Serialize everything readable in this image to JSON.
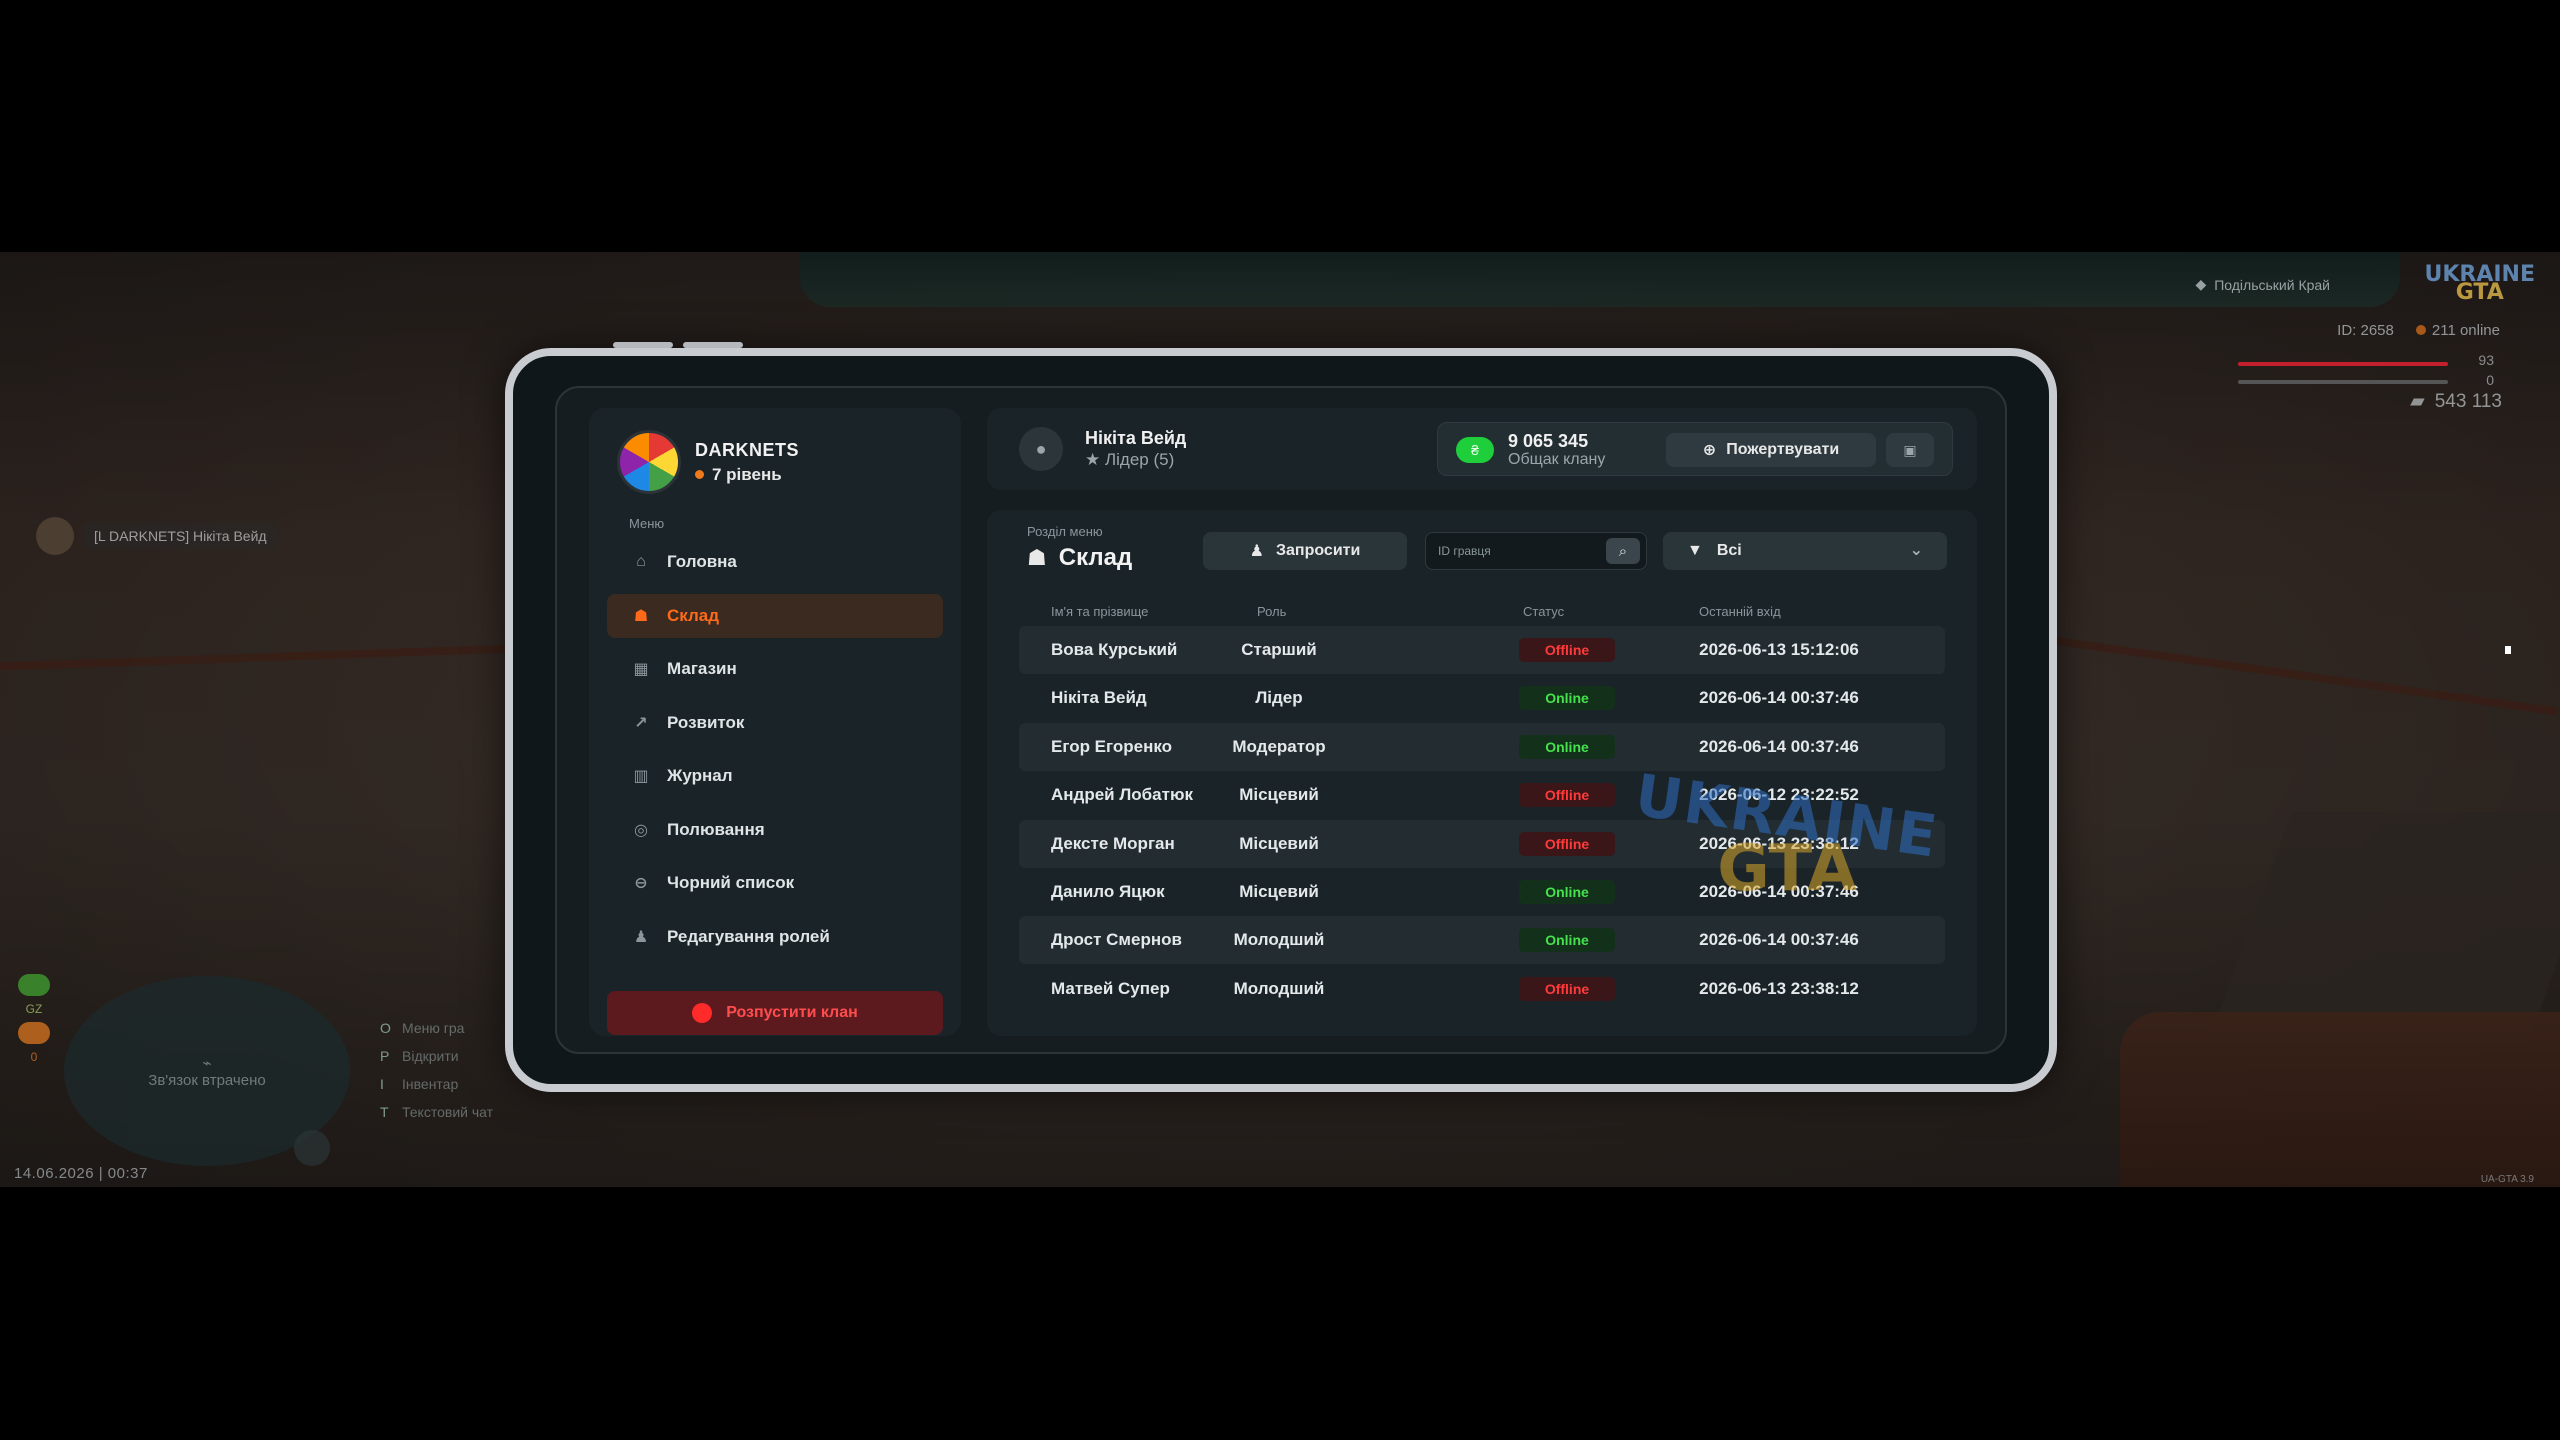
{
  "hud": {
    "region": "Подільський Край",
    "logo_top": "UKRAINE",
    "logo_bottom": "GTA",
    "player_id": "ID: 2658",
    "online": "211 online",
    "hp": "93",
    "armor": "0",
    "money": "543 113",
    "chat_tag": "[L DARKNETS] Нікіта Вейд",
    "minimap_text": "Зв'язок втрачено",
    "gz": "GZ",
    "gz_count": "0",
    "keys": [
      {
        "key": "O",
        "label": "Меню гра"
      },
      {
        "key": "P",
        "label": "Відкрити"
      },
      {
        "key": "I",
        "label": "Інвентар"
      },
      {
        "key": "T",
        "label": "Текстовий чат"
      }
    ],
    "datetime": "14.06.2026 | 00:37",
    "version": "UA-GTA 3.9"
  },
  "clan": {
    "name": "DARKNETS",
    "level": "7 рівень"
  },
  "menu": {
    "caption": "Меню",
    "items": [
      {
        "label": "Головна",
        "icon": "home-icon",
        "glyph": "⌂"
      },
      {
        "label": "Склад",
        "icon": "members-icon",
        "glyph": "☗"
      },
      {
        "label": "Магазин",
        "icon": "shop-basket-icon",
        "glyph": "▦"
      },
      {
        "label": "Розвиток",
        "icon": "chart-icon",
        "glyph": "↗"
      },
      {
        "label": "Журнал",
        "icon": "book-icon",
        "glyph": "▥"
      },
      {
        "label": "Полювання",
        "icon": "target-icon",
        "glyph": "◎"
      },
      {
        "label": "Чорний список",
        "icon": "block-icon",
        "glyph": "⊖"
      },
      {
        "label": "Редагування ролей",
        "icon": "user-edit-icon",
        "glyph": "♟"
      }
    ],
    "active_index": 1,
    "disband_label": "Розпустити клан"
  },
  "user": {
    "name": "Нікіта Вейд",
    "role": "★ Лідер (5)"
  },
  "bank": {
    "amount": "9 065 345",
    "label": "Общак клану",
    "donate_label": "Пожертвувати"
  },
  "section": {
    "caption": "Розділ меню",
    "title": "Склад",
    "invite_label": "Запросити",
    "search_placeholder": "ID гравця",
    "filter_value": "Всі"
  },
  "table": {
    "headers": [
      "Ім'я та прізвище",
      "Роль",
      "Статус",
      "Останній вхід"
    ],
    "rows": [
      {
        "name": "Вова Курський",
        "role": "Старший",
        "status": "Offline",
        "last": "2026-06-13 15:12:06"
      },
      {
        "name": "Нікіта Вейд",
        "role": "Лідер",
        "status": "Online",
        "last": "2026-06-14 00:37:46"
      },
      {
        "name": "Егор Егоренко",
        "role": "Модератор",
        "status": "Online",
        "last": "2026-06-14 00:37:46"
      },
      {
        "name": "Андрей Лобатюк",
        "role": "Місцевий",
        "status": "Offline",
        "last": "2026-06-12 23:22:52"
      },
      {
        "name": "Дексте Морган",
        "role": "Місцевий",
        "status": "Offline",
        "last": "2026-06-13 23:38:12"
      },
      {
        "name": "Данило Яцюк",
        "role": "Місцевий",
        "status": "Online",
        "last": "2026-06-14 00:37:46"
      },
      {
        "name": "Дрост Смернов",
        "role": "Молодший",
        "status": "Online",
        "last": "2026-06-14 00:37:46"
      },
      {
        "name": "Матвей Супер",
        "role": "Молодший",
        "status": "Offline",
        "last": "2026-06-13 23:38:12"
      }
    ]
  },
  "colors": {
    "accent": "#ff6a1a",
    "online": "#45e24d",
    "offline": "#ff3a3a",
    "panel": "#1a2327"
  }
}
